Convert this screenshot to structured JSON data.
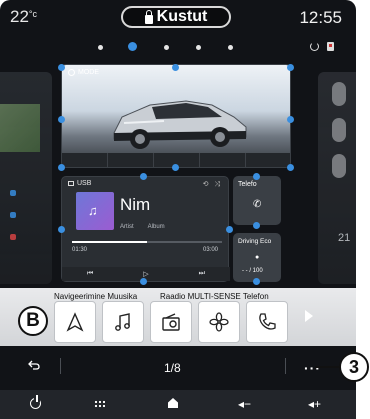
{
  "status": {
    "temperature": "22",
    "temperature_unit": "°c",
    "center_label": "Kustut",
    "time": "12:55"
  },
  "pager_dots": {
    "count": 5,
    "active_index": 1
  },
  "widgets": {
    "mode": {
      "label": "MODE"
    },
    "usb": {
      "source": "USB",
      "track": "Nim",
      "artist": "Artist",
      "album": "Album",
      "time_elapsed": "01:30",
      "time_total": "03:00",
      "progress": 0.5
    },
    "phone": {
      "label": "Telefo"
    },
    "driving_eco": {
      "label": "Driving Eco",
      "value": "- - / 100"
    },
    "right_partial_number": "21"
  },
  "favourites": {
    "group_labels": [
      "Navigeerimine Muusika",
      "Raadio MULTI-SENSE Telefon"
    ],
    "buttons": [
      {
        "icon": "navigation-arrow-icon"
      },
      {
        "icon": "music-note-icon"
      },
      {
        "icon": "radio-icon"
      },
      {
        "icon": "multi-sense-icon"
      },
      {
        "icon": "phone-icon"
      }
    ]
  },
  "pager": {
    "page": "1/8"
  },
  "callouts": {
    "b": "B",
    "three": "3"
  },
  "bottom_bar": {
    "volume_down": "◂−",
    "volume_up": "◂+"
  },
  "colors": {
    "accent": "#3a8fe0",
    "background": "#111317",
    "favourites_bar": "#e0e1e3"
  }
}
